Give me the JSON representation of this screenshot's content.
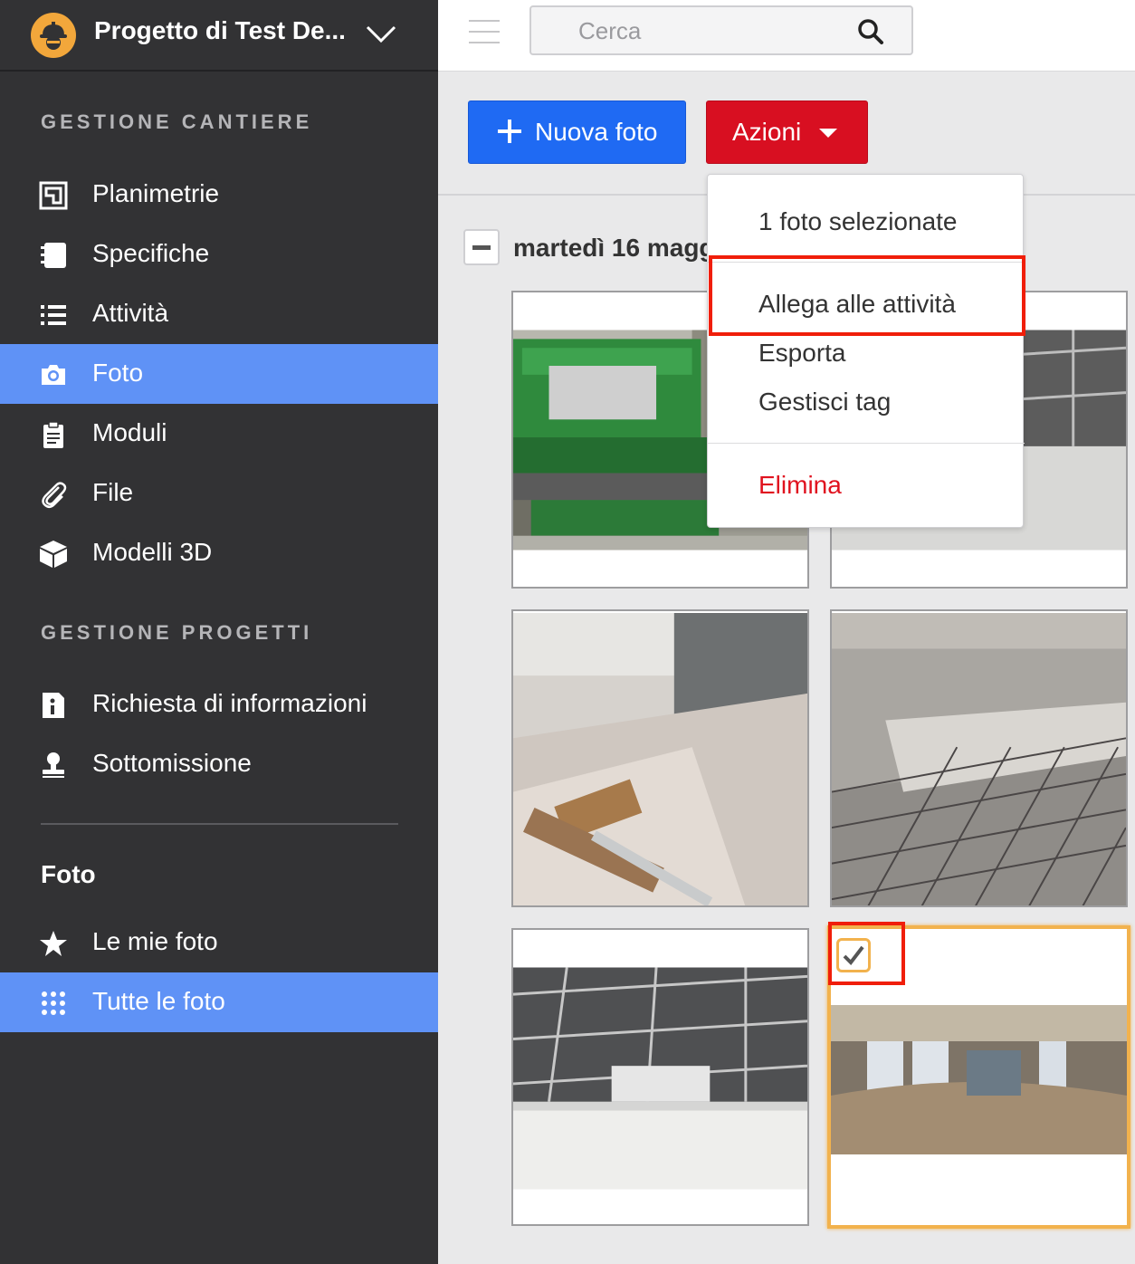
{
  "project": {
    "title": "Progetto di Test De...",
    "logo_icon": "worker-helmet-icon",
    "switch_icon": "chevron-down-icon"
  },
  "sidebar": {
    "section_site": "GESTIONE CANTIERE",
    "site_items": [
      {
        "label": "Planimetrie",
        "icon": "floorplan-icon"
      },
      {
        "label": "Specifiche",
        "icon": "notebook-icon"
      },
      {
        "label": "Attività",
        "icon": "list-icon"
      },
      {
        "label": "Foto",
        "icon": "camera-icon",
        "active": true
      },
      {
        "label": "Moduli",
        "icon": "clipboard-icon"
      },
      {
        "label": "File",
        "icon": "paperclip-icon"
      },
      {
        "label": "Modelli 3D",
        "icon": "cube-icon"
      }
    ],
    "section_project": "GESTIONE PROGETTI",
    "project_items": [
      {
        "label": "Richiesta di informazioni",
        "icon": "info-document-icon"
      },
      {
        "label": "Sottomissione",
        "icon": "stamp-icon"
      }
    ],
    "sub_title": "Foto",
    "photo_items": [
      {
        "label": "Le mie foto",
        "icon": "star-icon"
      },
      {
        "label": "Tutte le foto",
        "icon": "grid-dots-icon",
        "active": true
      }
    ]
  },
  "topbar": {
    "search_placeholder": "Cerca",
    "menu_icon": "hamburger-icon",
    "search_icon": "search-icon"
  },
  "toolbar": {
    "new_photo_label": "Nuova foto",
    "actions_label": "Azioni"
  },
  "group": {
    "date_label": "martedì 16 maggio"
  },
  "dropdown": {
    "selected_count_label": "1 foto selezionate",
    "attach_label": "Allega alle attività",
    "export_label": "Esporta",
    "tags_label": "Gestisci tag",
    "delete_label": "Elimina"
  },
  "colors": {
    "sidebar_bg": "#323234",
    "active": "#5f92f6",
    "primary": "#1f6af3",
    "danger": "#d80f21",
    "selection": "#f2b24d",
    "highlight": "#f01e0a"
  }
}
